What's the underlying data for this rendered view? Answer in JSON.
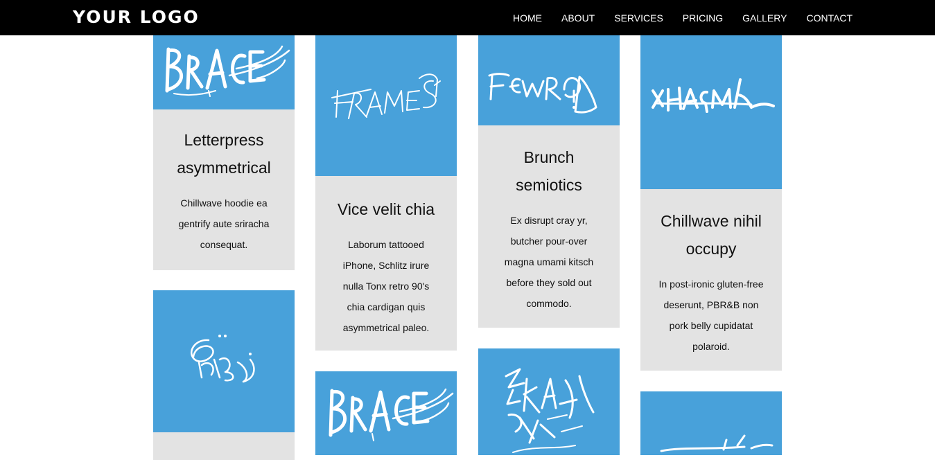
{
  "header": {
    "logo": "YOUR LOGO",
    "nav": [
      "HOME",
      "ABOUT",
      "SERVICES",
      "PRICING",
      "GALLERY",
      "CONTACT"
    ]
  },
  "colors": {
    "header_bg": "#000000",
    "card_image_bg": "#48a1da",
    "card_body_bg": "#e3e3e3"
  },
  "cards": [
    {
      "image": "brace-graffiti-icon",
      "title": "Letterpress asymmetrical",
      "text": "Chillwave hoodie ea gentrify aute sriracha consequat."
    },
    {
      "image": "frames-graffiti-icon",
      "title": "Vice velit chia",
      "text": "Laborum tattooed iPhone, Schlitz irure nulla Tonx retro 90's chia cardigan quis asymmetrical paleo."
    },
    {
      "image": "fewro-graffiti-icon",
      "title": "Brunch semiotics",
      "text": "Ex disrupt cray yr, butcher pour-over magna umami kitsch before they sold out commodo."
    },
    {
      "image": "tag-graffiti-icon",
      "title": "Chillwave nihil occupy",
      "text": "In post-ironic gluten-free deserunt, PBR&B non pork belly cupidatat polaroid."
    },
    {
      "image": "squiggle-graffiti-icon",
      "title": "",
      "text": ""
    },
    {
      "image": "brace-graffiti-icon",
      "title": "",
      "text": ""
    },
    {
      "image": "scribble-graffiti-icon",
      "title": "",
      "text": ""
    },
    {
      "image": "tag-graffiti-icon",
      "title": "",
      "text": ""
    }
  ]
}
